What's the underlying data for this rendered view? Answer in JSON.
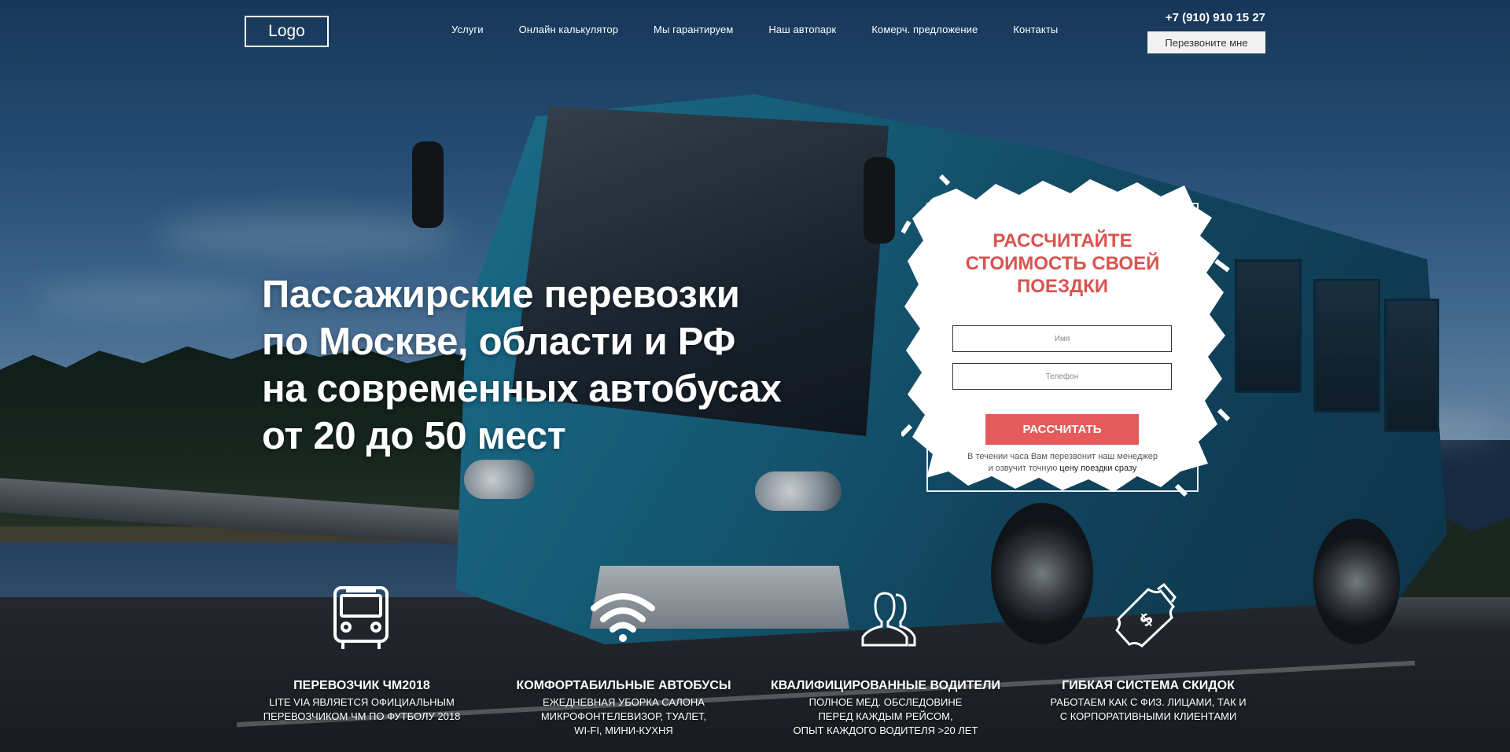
{
  "header": {
    "logo": "Logo",
    "nav": [
      "Услуги",
      "Онлайн калькулятор",
      "Мы гарантируем",
      "Наш автопарк",
      "Комерч. предложение",
      "Контакты"
    ],
    "phone": "+7 (910) 910 15 27",
    "callback_label": "Перезвоните мне"
  },
  "hero": {
    "title_lines": [
      "Пассажирские перевозки",
      "по Москве, области и РФ",
      "на современных автобусах",
      "от 20 до 50 мест"
    ]
  },
  "form": {
    "title_lines": [
      "РАССЧИТАЙТЕ",
      "СТОИМОСТЬ СВОЕЙ",
      "ПОЕЗДКИ"
    ],
    "name_placeholder": "Имя",
    "phone_placeholder": "Телефон",
    "submit_label": "РАССЧИТАТЬ",
    "note_line1": "В течении часа Вам перезвонит наш менеджер",
    "note_line2_prefix": "и озвучит точную ",
    "note_line2_link": "цену поездки сразу"
  },
  "features": [
    {
      "icon": "bus-icon",
      "title": "ПЕРЕВОЗЧИК ЧМ2018",
      "lines": [
        "LITE VIA ЯВЛЯЕТСЯ ОФИЦИАЛЬНЫМ",
        "ПЕРЕВОЗЧИКОМ ЧМ ПО ФУТБОЛУ 2018"
      ]
    },
    {
      "icon": "wifi-icon",
      "title": "КОМФОРТАБИЛЬНЫЕ АВТОБУСЫ",
      "lines": [
        "ЕЖЕДНЕВНАЯ УБОРКА САЛОНА",
        "МИКРОФОНТЕЛЕВИЗОР, ТУАЛЕТ,",
        "WI-FI, МИНИ-КУХНЯ"
      ]
    },
    {
      "icon": "users-icon",
      "title": "КВАЛИФИЦИРОВАННЫЕ ВОДИТЕЛИ",
      "lines": [
        "ПОЛНОЕ МЕД. ОБСЛЕДОВИНЕ",
        "ПЕРЕД КАЖДЫМ РЕЙСОМ,",
        "ОПЫТ КАЖДОГО ВОДИТЕЛЯ >20 ЛЕТ"
      ]
    },
    {
      "icon": "money-icon",
      "title": "ГИБКАЯ СИСТЕМА СКИДОК",
      "lines": [
        "РАБОТАЕМ КАК С ФИЗ. ЛИЦАМИ, ТАК И",
        "С КОРПОРАТИВНЫМИ КЛИЕНТАМИ"
      ]
    }
  ],
  "colors": {
    "accent": "#e55b5b",
    "form_title": "#d9534f"
  }
}
